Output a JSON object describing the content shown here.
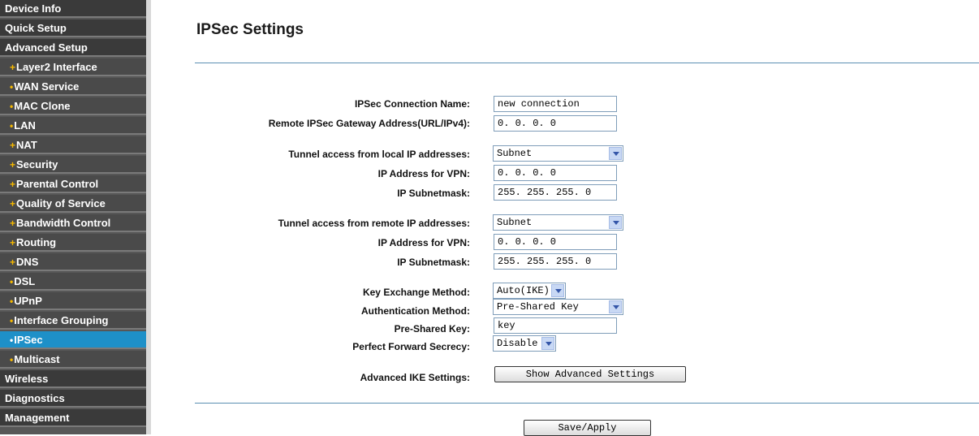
{
  "sidebar": {
    "items": [
      {
        "label": "Device Info",
        "type": "main",
        "bullet": ""
      },
      {
        "label": "Quick Setup",
        "type": "main",
        "bullet": ""
      },
      {
        "label": "Advanced Setup",
        "type": "main",
        "bullet": ""
      },
      {
        "label": "Layer2 Interface",
        "type": "sub",
        "bullet": "+"
      },
      {
        "label": "WAN Service",
        "type": "sub",
        "bullet": "•"
      },
      {
        "label": "MAC Clone",
        "type": "sub",
        "bullet": "•"
      },
      {
        "label": "LAN",
        "type": "sub",
        "bullet": "•"
      },
      {
        "label": "NAT",
        "type": "sub",
        "bullet": "+"
      },
      {
        "label": "Security",
        "type": "sub",
        "bullet": "+"
      },
      {
        "label": "Parental Control",
        "type": "sub",
        "bullet": "+"
      },
      {
        "label": "Quality of Service",
        "type": "sub",
        "bullet": "+"
      },
      {
        "label": "Bandwidth Control",
        "type": "sub",
        "bullet": "+"
      },
      {
        "label": "Routing",
        "type": "sub",
        "bullet": "+"
      },
      {
        "label": "DNS",
        "type": "sub",
        "bullet": "+"
      },
      {
        "label": "DSL",
        "type": "sub",
        "bullet": "•"
      },
      {
        "label": "UPnP",
        "type": "sub",
        "bullet": "•"
      },
      {
        "label": "Interface Grouping",
        "type": "sub",
        "bullet": "•"
      },
      {
        "label": "IPSec",
        "type": "sub",
        "bullet": "•",
        "active": true
      },
      {
        "label": "Multicast",
        "type": "sub",
        "bullet": "•"
      },
      {
        "label": "Wireless",
        "type": "main",
        "bullet": ""
      },
      {
        "label": "Diagnostics",
        "type": "main",
        "bullet": ""
      },
      {
        "label": "Management",
        "type": "main",
        "bullet": ""
      }
    ]
  },
  "page": {
    "title": "IPSec Settings"
  },
  "form": {
    "connection_name": {
      "label": "IPSec Connection Name:",
      "value": "new connection"
    },
    "remote_gateway": {
      "label": "Remote IPSec Gateway Address(URL/IPv4):",
      "value": "0. 0. 0. 0"
    },
    "local_access": {
      "label": "Tunnel access from local IP addresses:",
      "value": "Subnet"
    },
    "local_ip": {
      "label": "IP Address for VPN:",
      "value": "0. 0. 0. 0"
    },
    "local_mask": {
      "label": "IP Subnetmask:",
      "value": "255. 255. 255. 0"
    },
    "remote_access": {
      "label": "Tunnel access from remote IP addresses:",
      "value": "Subnet"
    },
    "remote_ip": {
      "label": "IP Address for VPN:",
      "value": "0. 0. 0. 0"
    },
    "remote_mask": {
      "label": "IP Subnetmask:",
      "value": "255. 255. 255. 0"
    },
    "key_exchange": {
      "label": "Key Exchange Method:",
      "value": "Auto(IKE)"
    },
    "auth_method": {
      "label": "Authentication Method:",
      "value": "Pre-Shared Key"
    },
    "psk": {
      "label": "Pre-Shared Key:",
      "value": "key"
    },
    "pfs": {
      "label": "Perfect Forward Secrecy:",
      "value": "Disable"
    },
    "advanced_ike": {
      "label": "Advanced IKE Settings:",
      "button": "Show Advanced Settings"
    }
  },
  "actions": {
    "save_label": "Save/Apply"
  },
  "colors": {
    "accent": "#1e90c8",
    "sidebar_bg": "#444444",
    "bullet": "#f5b800",
    "rule": "#5c8fb2"
  }
}
